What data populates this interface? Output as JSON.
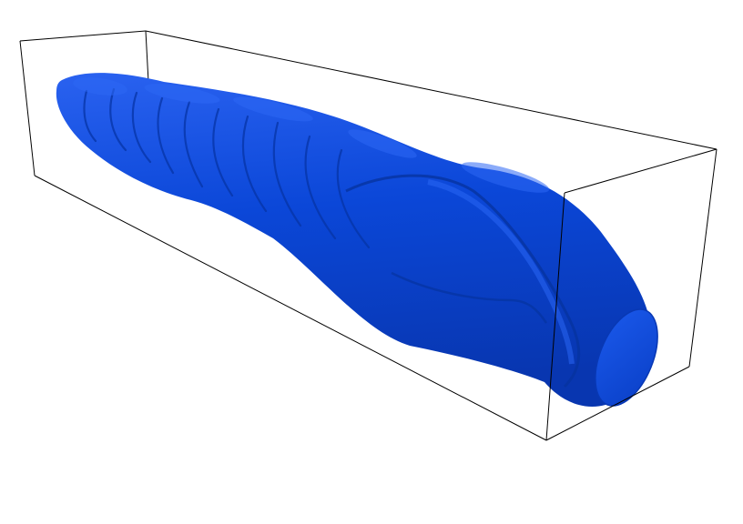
{
  "scene": {
    "background_color": "#ffffff",
    "bounding_box_color": "#000000",
    "surface_color": "#0a46d6",
    "surface_highlight_color": "#2a64f2",
    "surface_shadow_color": "#072f9c",
    "object": "blue-deformed-cylinder-isosurface"
  }
}
